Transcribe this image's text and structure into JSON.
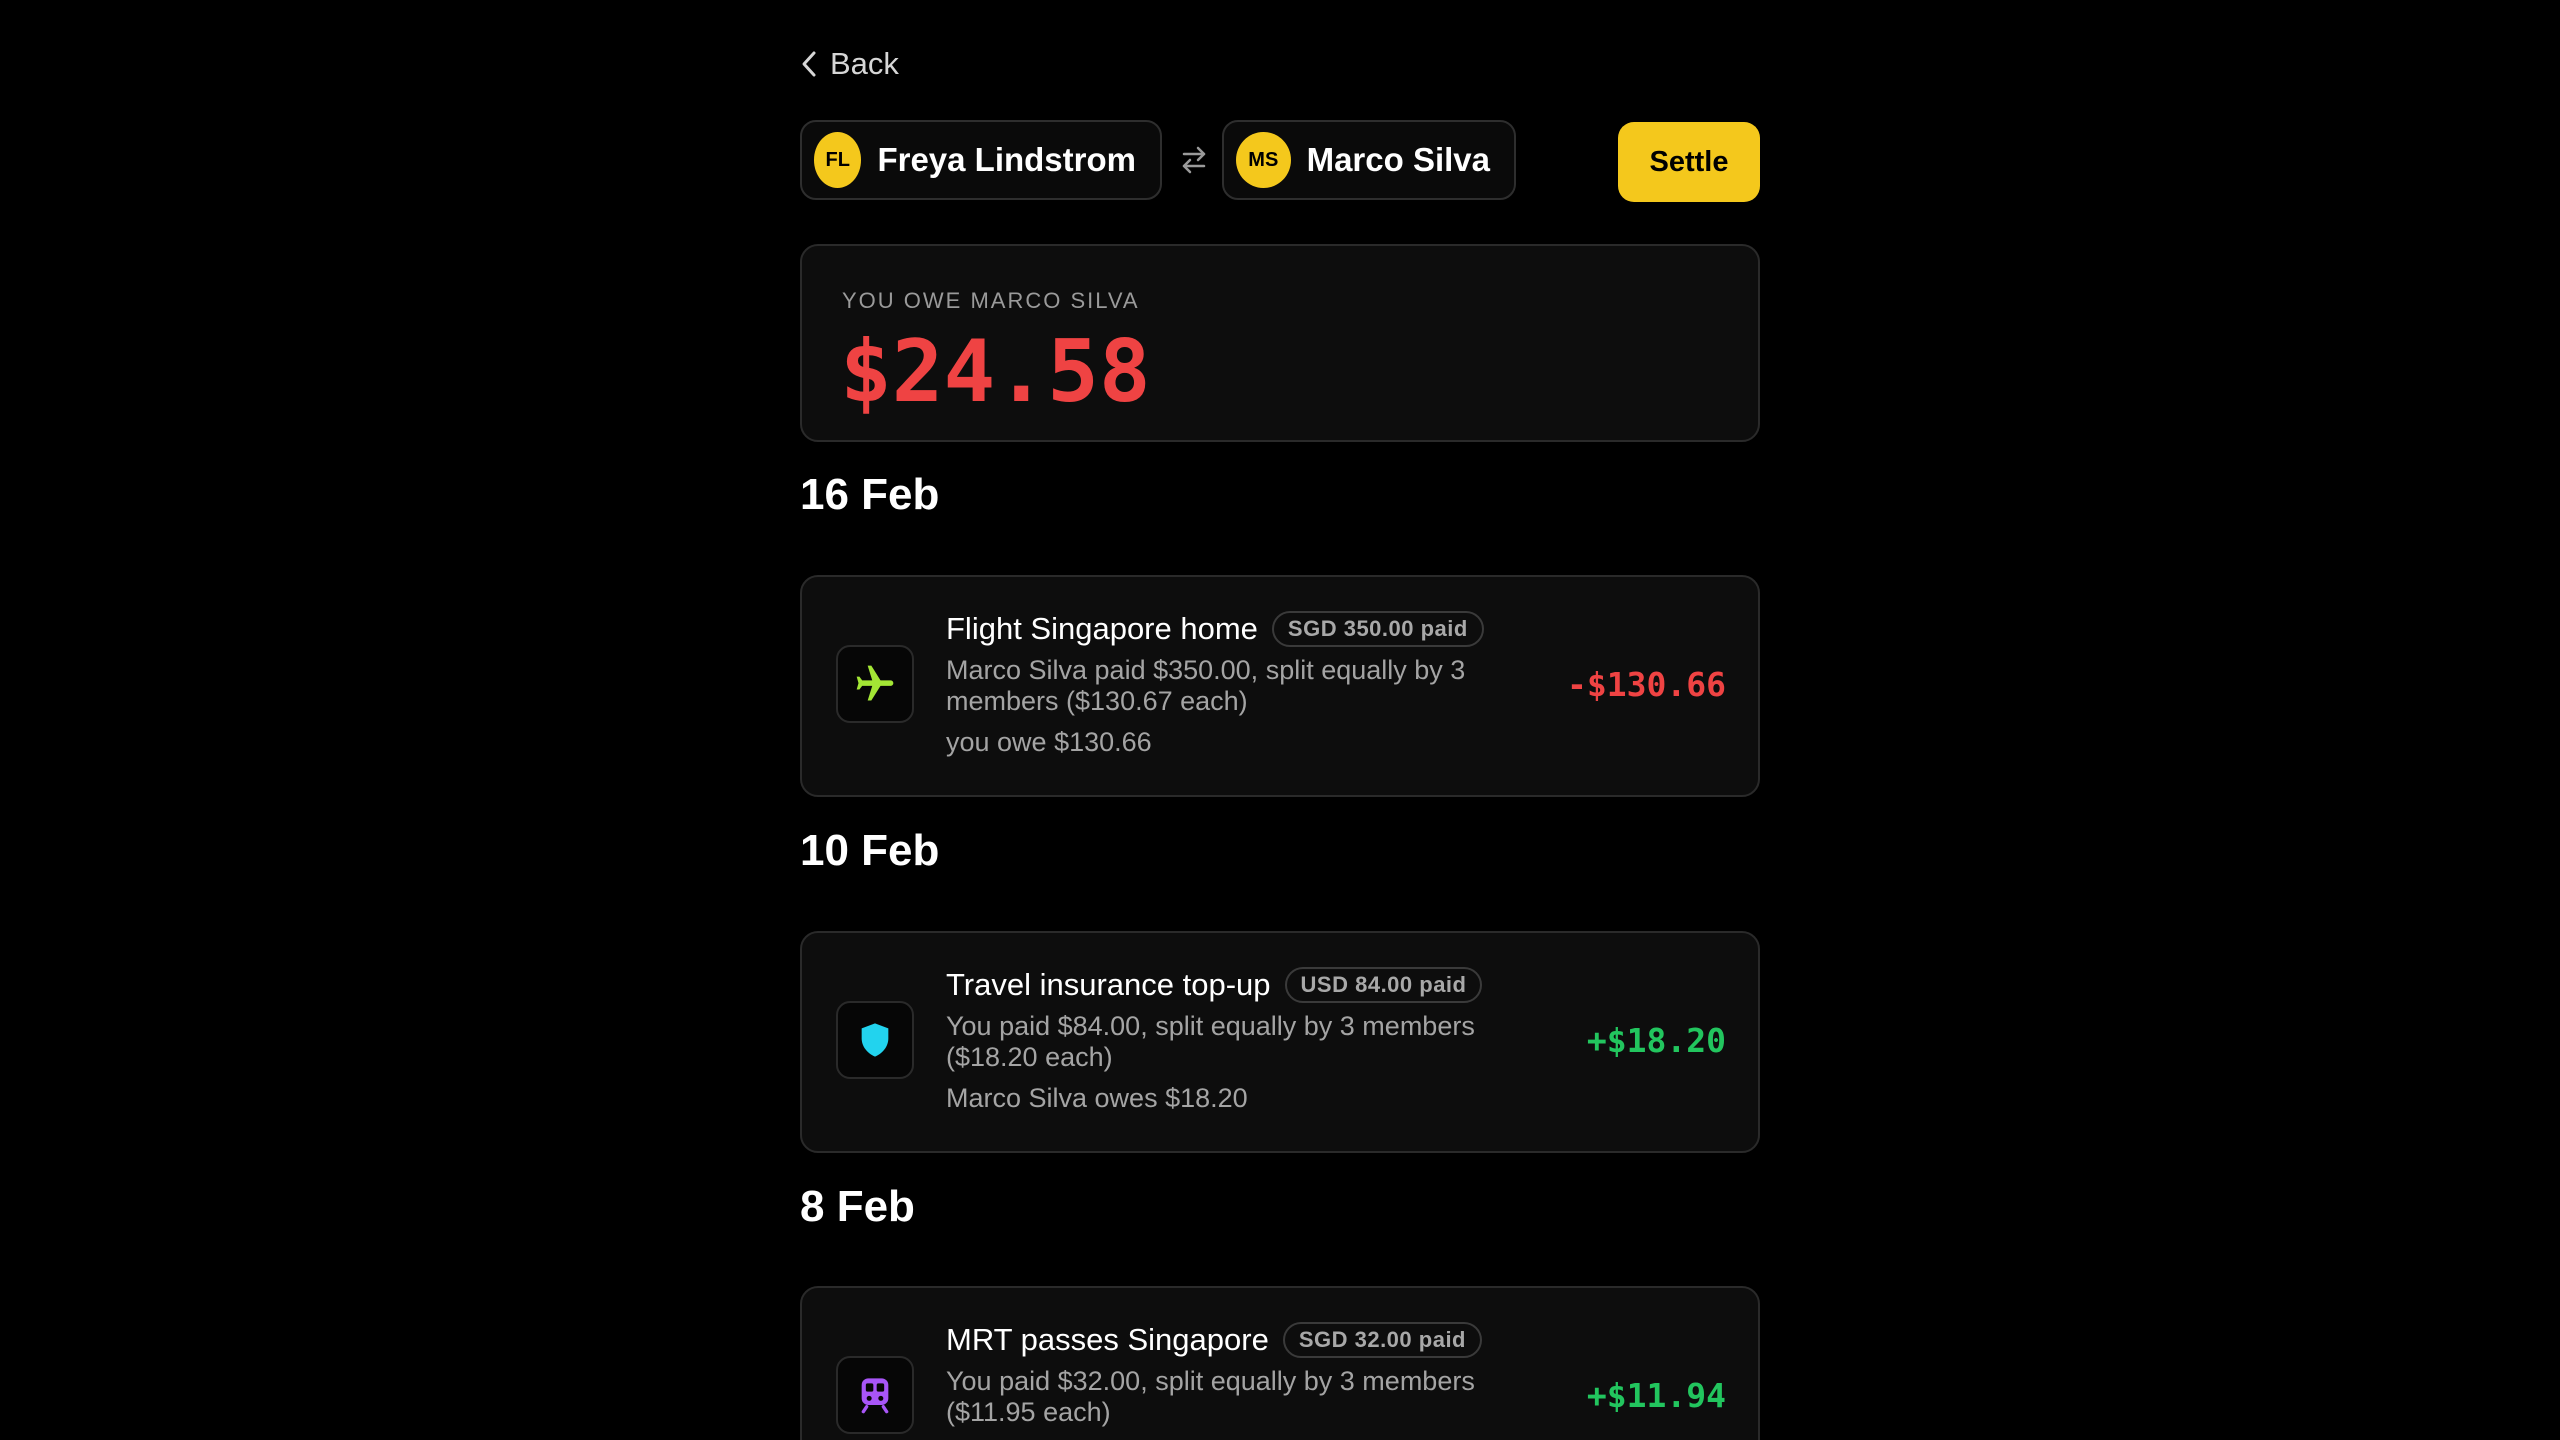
{
  "nav": {
    "back_label": "Back"
  },
  "pair": {
    "person_a": {
      "initials": "FL",
      "name": "Freya Lindstrom"
    },
    "person_b": {
      "initials": "MS",
      "name": "Marco Silva"
    },
    "settle_label": "Settle"
  },
  "summary": {
    "label": "YOU OWE MARCO SILVA",
    "amount": "$24.58"
  },
  "groups": [
    {
      "date": "16 Feb",
      "transaction": {
        "icon": "airplane-icon",
        "title": "Flight Singapore home",
        "badge": "SGD 350.00 paid",
        "description": "Marco Silva paid $350.00, split equally by 3 members ($130.67 each)",
        "share": "you owe $130.66",
        "amount": "-$130.66"
      }
    },
    {
      "date": "10 Feb",
      "transaction": {
        "icon": "shield-icon",
        "title": "Travel insurance top-up",
        "badge": "USD 84.00 paid",
        "description": "You paid $84.00, split equally by 3 members ($18.20 each)",
        "share": "Marco Silva owes $18.20",
        "amount": "+$18.20"
      }
    },
    {
      "date": "8 Feb",
      "transaction": {
        "icon": "train-icon",
        "title": "MRT passes Singapore",
        "badge": "SGD 32.00 paid",
        "description": "You paid $32.00, split equally by 3 members ($11.95 each)",
        "share": "",
        "amount": "+$11.94"
      }
    }
  ],
  "colors": {
    "accent": "#f4c81c",
    "negative": "#ef4343",
    "positive": "#22c55e",
    "airplane_icon": "#a3e635",
    "shield_icon": "#22d3ee",
    "train_icon": "#a855f7"
  }
}
